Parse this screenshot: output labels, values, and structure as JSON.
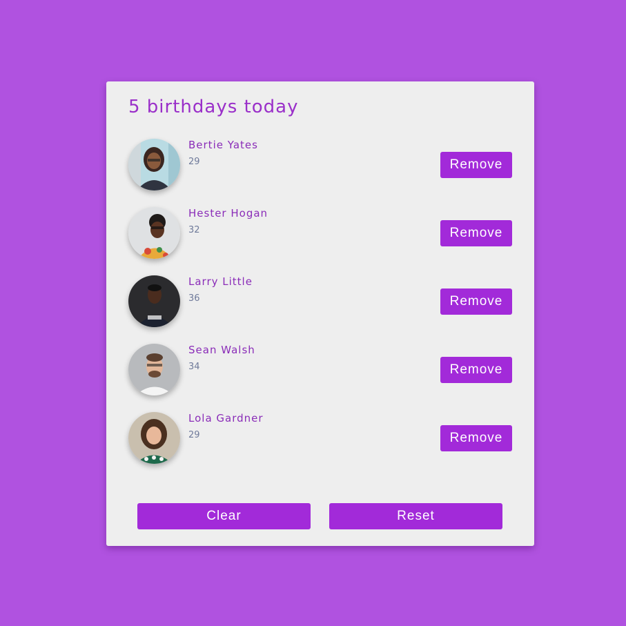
{
  "header": {
    "title": "5 birthdays today"
  },
  "people": [
    {
      "name": "Bertie Yates",
      "age": "29",
      "button": "Remove",
      "avatar_icon": "person-photo-icon"
    },
    {
      "name": "Hester Hogan",
      "age": "32",
      "button": "Remove",
      "avatar_icon": "person-photo-icon"
    },
    {
      "name": "Larry Little",
      "age": "36",
      "button": "Remove",
      "avatar_icon": "person-photo-icon"
    },
    {
      "name": "Sean Walsh",
      "age": "34",
      "button": "Remove",
      "avatar_icon": "person-photo-icon"
    },
    {
      "name": "Lola Gardner",
      "age": "29",
      "button": "Remove",
      "avatar_icon": "person-photo-icon"
    }
  ],
  "actions": {
    "clear_label": "Clear",
    "reset_label": "Reset"
  },
  "colors": {
    "background": "#b052e0",
    "card": "#eeeeee",
    "accent": "#a22ad9",
    "title": "#9a2fc9",
    "age": "#6f7a9a"
  }
}
